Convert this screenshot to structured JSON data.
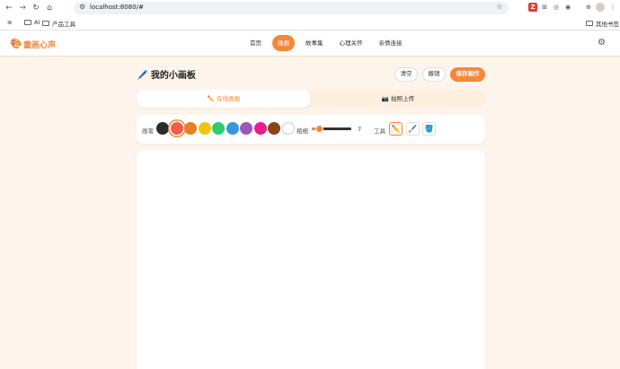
{
  "browser": {
    "url": "localhost:8080/#",
    "bookmarks": [
      {
        "label": "AI"
      },
      {
        "label": "产品工具"
      }
    ],
    "other_bookmarks": "其他书签"
  },
  "app": {
    "logo_text": "童画心声",
    "menu": [
      {
        "label": "首页",
        "active": false
      },
      {
        "label": "画画",
        "active": true
      },
      {
        "label": "故事集",
        "active": false
      },
      {
        "label": "心理关怀",
        "active": false
      },
      {
        "label": "亲情连接",
        "active": false
      }
    ]
  },
  "page": {
    "title": "🖊️ 我的小画板",
    "buttons": {
      "clear": "清空",
      "undo": "撤销",
      "save": "保存画作"
    },
    "tabs": [
      {
        "label": "✏️ 在线画画",
        "active": true
      },
      {
        "label": "📷 拍照上传",
        "active": false
      }
    ],
    "toolbar": {
      "brush_label": "画笔",
      "size_label": "粗细",
      "size_value": "7",
      "size_fraction": 0.2,
      "tools_label": "工具",
      "colors": [
        "#2b2b2b",
        "#f25c4b",
        "#e67e22",
        "#f1c40f",
        "#2ecc71",
        "#3498db",
        "#9b59b6",
        "#e91e8c",
        "#8b4513",
        "#ffffff"
      ],
      "selected_color_index": 1,
      "tools": [
        {
          "icon": "pencil-icon",
          "glyph": "✏️",
          "active": true
        },
        {
          "icon": "brush-icon",
          "glyph": "🖌️",
          "active": false
        },
        {
          "icon": "bucket-icon",
          "glyph": "🪣",
          "active": false
        }
      ]
    }
  }
}
